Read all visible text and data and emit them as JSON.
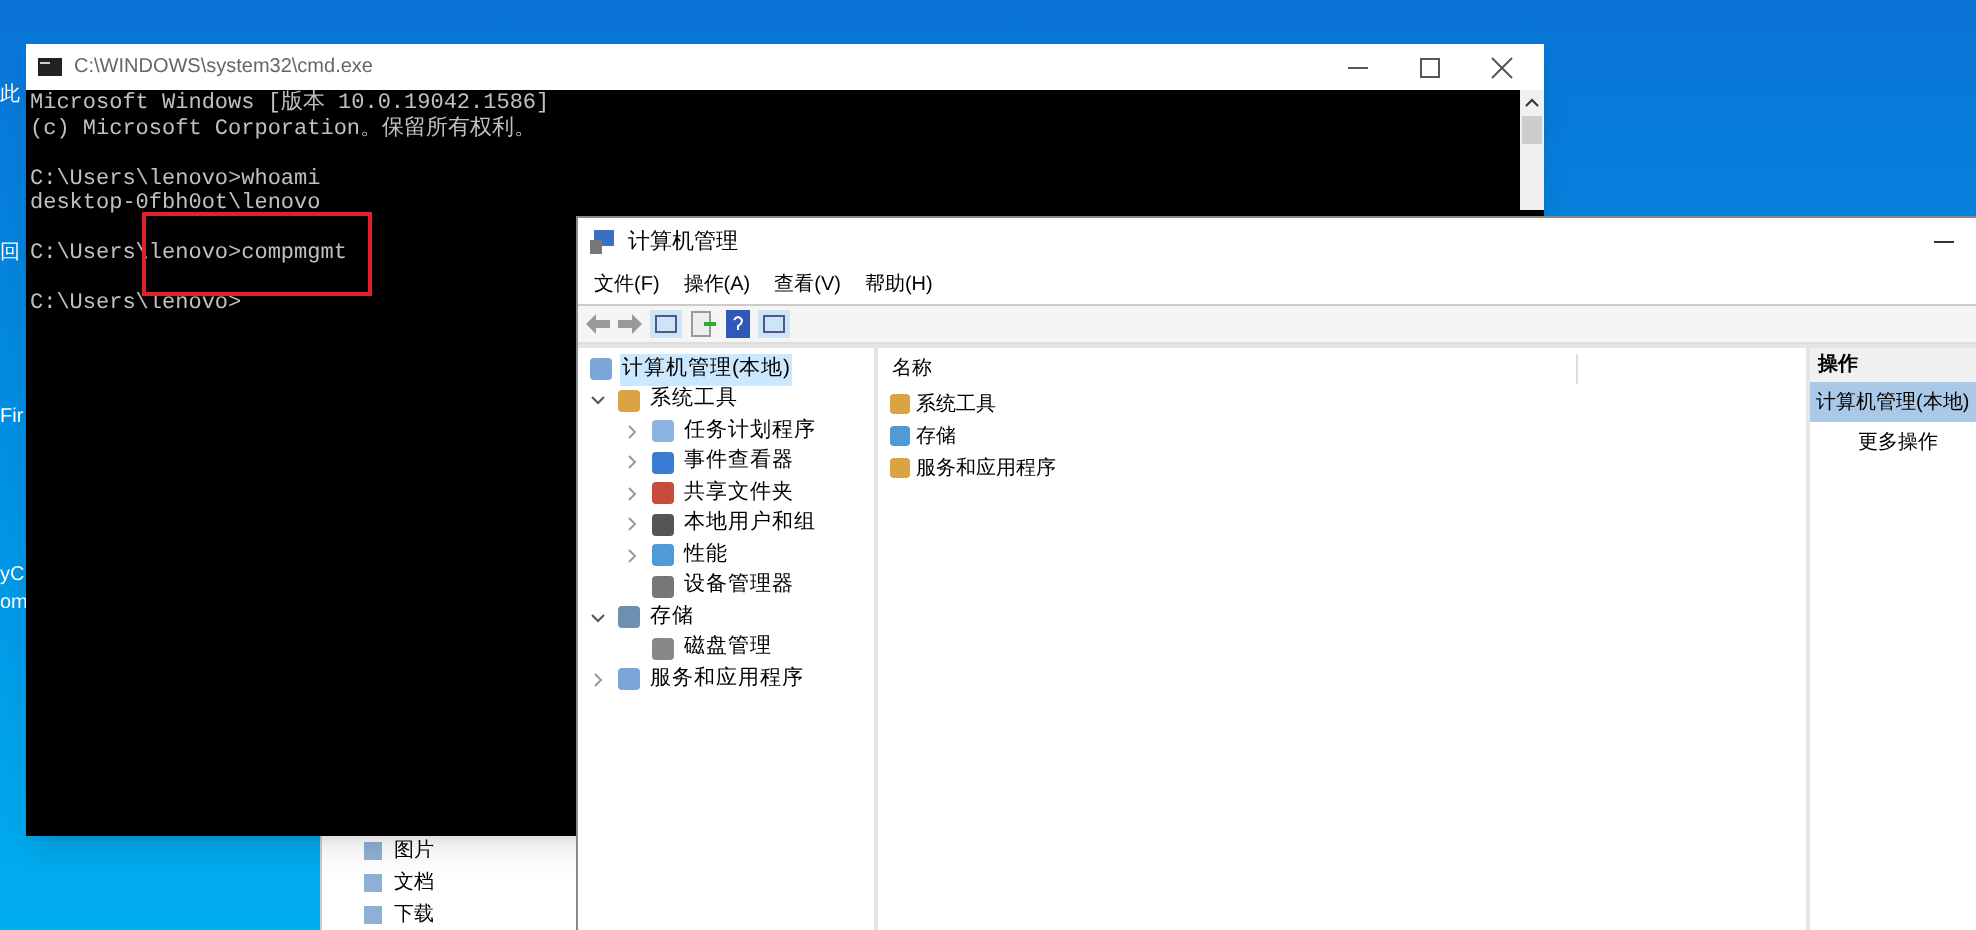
{
  "desktop_icons": [
    {
      "label": "此"
    },
    {
      "label": "回"
    },
    {
      "label": "Fir"
    },
    {
      "label": "yC"
    },
    {
      "label": "om"
    }
  ],
  "explorer_window": {
    "items": [
      {
        "label": "图片"
      },
      {
        "label": "文档"
      },
      {
        "label": "下载"
      }
    ]
  },
  "cmd_window": {
    "title": "C:\\WINDOWS\\system32\\cmd.exe",
    "blocks": [
      [
        "Microsoft Windows [版本 10.0.19042.1586]",
        "(c) Microsoft Corporation。保留所有权利。"
      ],
      [
        "C:\\Users\\lenovo>whoami",
        "desktop-0fbh0ot\\lenovo"
      ],
      [
        "C:\\Users\\lenovo>compmgmt"
      ],
      [
        "C:\\Users\\lenovo>"
      ]
    ]
  },
  "compmgmt_window": {
    "title": "计算机管理",
    "menu": [
      "文件(F)",
      "操作(A)",
      "查看(V)",
      "帮助(H)"
    ],
    "tree": [
      {
        "label": "计算机管理(本地)",
        "selected": true,
        "children": [
          {
            "label": "系统工具",
            "expanded": true,
            "selected": false,
            "children": [
              {
                "label": "任务计划程序",
                "expanded": false,
                "selected": false
              },
              {
                "label": "事件查看器",
                "expanded": false,
                "selected": false
              },
              {
                "label": "共享文件夹",
                "expanded": false,
                "selected": false
              },
              {
                "label": "本地用户和组",
                "expanded": false,
                "selected": false
              },
              {
                "label": "性能",
                "expanded": false,
                "selected": false
              },
              {
                "label": "设备管理器",
                "selected": false
              }
            ]
          },
          {
            "label": "存储",
            "expanded": true,
            "selected": false,
            "children": [
              {
                "label": "磁盘管理",
                "selected": false
              }
            ]
          },
          {
            "label": "服务和应用程序",
            "expanded": false,
            "selected": false
          }
        ]
      }
    ],
    "content": {
      "column": "名称",
      "items": [
        {
          "label": "系统工具"
        },
        {
          "label": "存储"
        },
        {
          "label": "服务和应用程序"
        }
      ]
    },
    "actions": {
      "header": "操作",
      "items": [
        {
          "label": "计算机管理(本地)",
          "selected": true
        },
        {
          "label": "更多操作",
          "selected": false
        }
      ]
    }
  }
}
